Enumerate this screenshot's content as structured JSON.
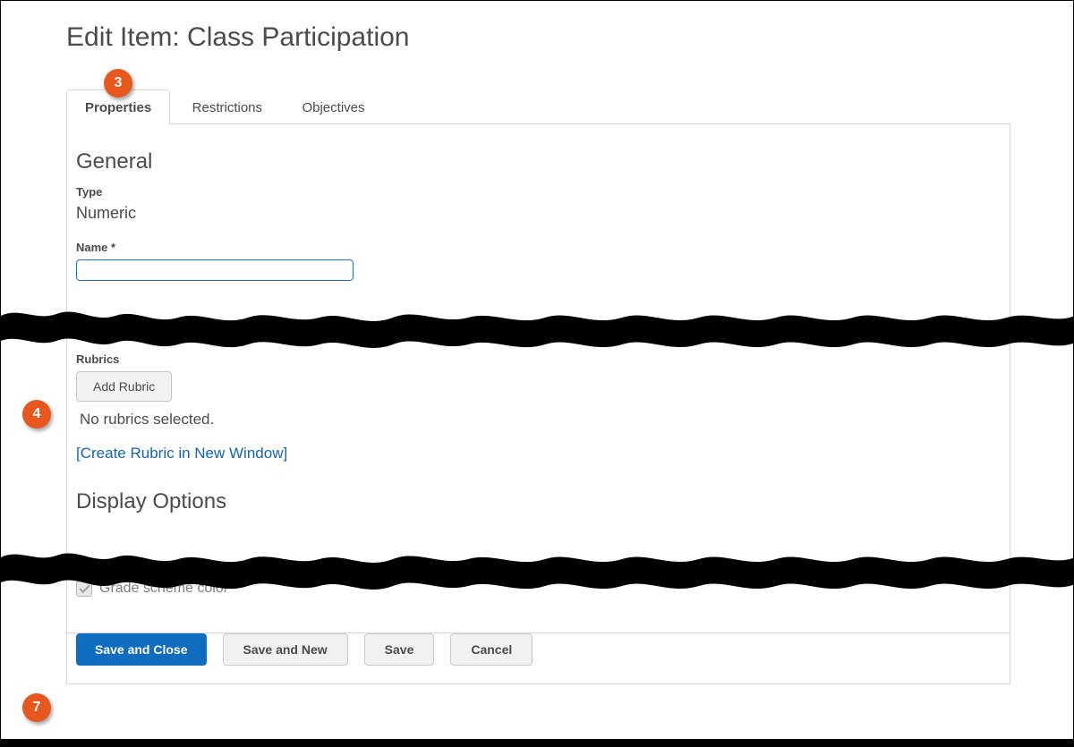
{
  "header": {
    "title": "Edit Item: Class Participation"
  },
  "tabs": {
    "properties": "Properties",
    "restrictions": "Restrictions",
    "objectives": "Objectives"
  },
  "general": {
    "heading": "General",
    "type_label": "Type",
    "type_value": "Numeric",
    "name_label": "Name ",
    "name_required_marker": "*",
    "name_value": ""
  },
  "rubrics": {
    "label": "Rubrics",
    "add_button": "Add Rubric",
    "none_selected": "No rubrics selected.",
    "create_link": "[Create Rubric in New Window]"
  },
  "display": {
    "heading": "Display Options",
    "grade_scheme_color": "Grade scheme color"
  },
  "footer": {
    "save_close": "Save and Close",
    "save_new": "Save and New",
    "save": "Save",
    "cancel": "Cancel"
  },
  "callouts": {
    "c3": "3",
    "c4": "4",
    "c7": "7"
  },
  "colors": {
    "accent": "#e8571e",
    "primary": "#0f6cbf",
    "link": "#1763aa"
  }
}
